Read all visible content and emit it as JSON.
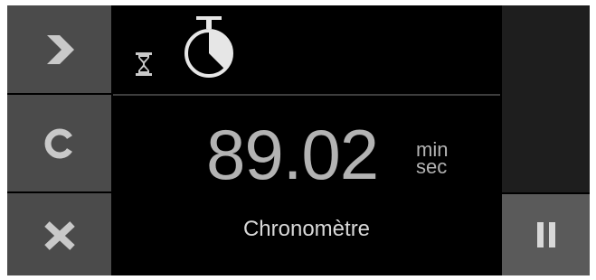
{
  "left_buttons": [
    {
      "name": "next",
      "icon": "chevron-right-icon"
    },
    {
      "name": "clear",
      "icon": "letter-c-icon"
    },
    {
      "name": "cancel",
      "icon": "letter-x-icon"
    }
  ],
  "status_icons": [
    "hourglass-icon",
    "stopwatch-icon"
  ],
  "timer": {
    "value": "89.02",
    "unit_top": "min",
    "unit_bottom": "sec"
  },
  "mode_label": "Chronomètre",
  "pause_icon": "pause-icon",
  "colors": {
    "background": "#000000",
    "button": "#4b4b4b",
    "icon": "#c2c2c2",
    "text": "#b3b3b3"
  }
}
